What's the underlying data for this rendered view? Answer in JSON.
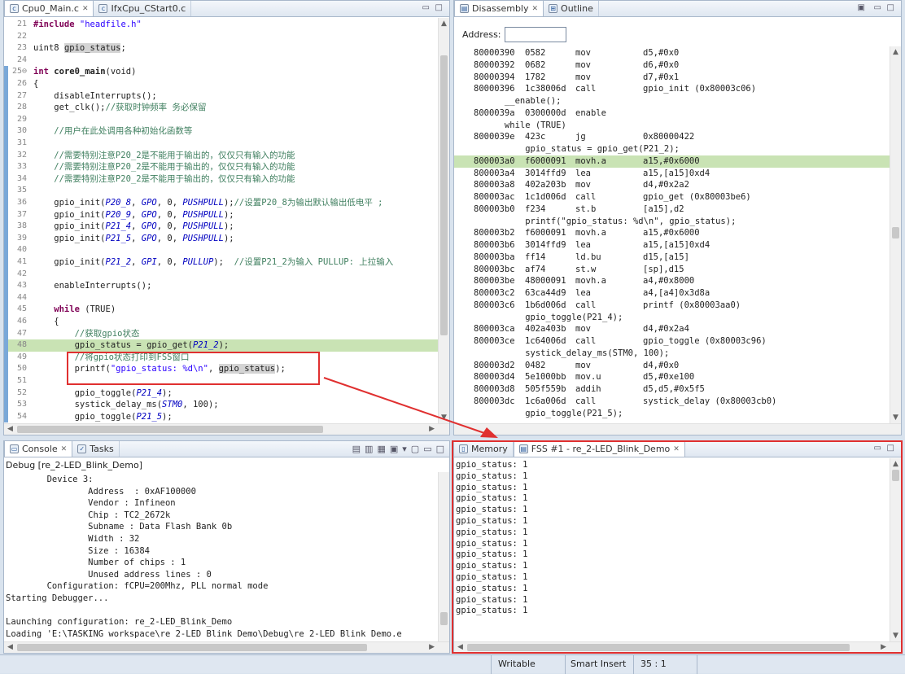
{
  "editor": {
    "tabs": [
      {
        "label": "Cpu0_Main.c",
        "close": "✕"
      },
      {
        "label": "IfxCpu_CStart0.c"
      }
    ],
    "lines": [
      {
        "n": "21",
        "tokens": [
          {
            "t": "#include ",
            "c": "kw"
          },
          {
            "t": "\"headfile.h\"",
            "c": "str"
          }
        ]
      },
      {
        "n": "22",
        "tokens": []
      },
      {
        "n": "23",
        "tokens": [
          {
            "t": "uint8 ",
            "c": ""
          },
          {
            "t": "gpio_status",
            "c": "hl"
          },
          {
            "t": ";",
            "c": ""
          }
        ]
      },
      {
        "n": "24",
        "tokens": []
      },
      {
        "n": "25⊖",
        "tokens": [
          {
            "t": "int ",
            "c": "kw"
          },
          {
            "t": "core0_main",
            "c": "b"
          },
          {
            "t": "(void)",
            "c": ""
          }
        ]
      },
      {
        "n": "26",
        "tokens": [
          {
            "t": "{",
            "c": ""
          }
        ]
      },
      {
        "n": "27",
        "tokens": [
          {
            "t": "    disableInterrupts();",
            "c": ""
          }
        ]
      },
      {
        "n": "28",
        "tokens": [
          {
            "t": "    get_clk();",
            "c": ""
          },
          {
            "t": "//获取时钟频率 务必保留",
            "c": "cm"
          }
        ]
      },
      {
        "n": "29",
        "tokens": []
      },
      {
        "n": "30",
        "tokens": [
          {
            "t": "    //用户在此处调用各种初始化函数等",
            "c": "cm"
          }
        ]
      },
      {
        "n": "31",
        "tokens": []
      },
      {
        "n": "32",
        "tokens": [
          {
            "t": "    //需要特别注意P20_2是不能用于输出的，仅仅只有输入的功能",
            "c": "cm"
          }
        ]
      },
      {
        "n": "33",
        "tokens": [
          {
            "t": "    //需要特别注意P20_2是不能用于输出的，仅仅只有输入的功能",
            "c": "cm"
          }
        ]
      },
      {
        "n": "34",
        "tokens": [
          {
            "t": "    //需要特别注意P20_2是不能用于输出的，仅仅只有输入的功能",
            "c": "cm"
          }
        ]
      },
      {
        "n": "35",
        "tokens": []
      },
      {
        "n": "36",
        "tokens": [
          {
            "t": "    gpio_init(",
            "c": ""
          },
          {
            "t": "P20_8",
            "c": "it"
          },
          {
            "t": ", ",
            "c": ""
          },
          {
            "t": "GPO",
            "c": "it"
          },
          {
            "t": ", 0, ",
            "c": ""
          },
          {
            "t": "PUSHPULL",
            "c": "it"
          },
          {
            "t": ");",
            "c": ""
          },
          {
            "t": "//设置P20_8为输出默认输出低电平 ;",
            "c": "cm"
          }
        ]
      },
      {
        "n": "37",
        "tokens": [
          {
            "t": "    gpio_init(",
            "c": ""
          },
          {
            "t": "P20_9",
            "c": "it"
          },
          {
            "t": ", ",
            "c": ""
          },
          {
            "t": "GPO",
            "c": "it"
          },
          {
            "t": ", 0, ",
            "c": ""
          },
          {
            "t": "PUSHPULL",
            "c": "it"
          },
          {
            "t": ");",
            "c": ""
          }
        ]
      },
      {
        "n": "38",
        "tokens": [
          {
            "t": "    gpio_init(",
            "c": ""
          },
          {
            "t": "P21_4",
            "c": "it"
          },
          {
            "t": ", ",
            "c": ""
          },
          {
            "t": "GPO",
            "c": "it"
          },
          {
            "t": ", 0, ",
            "c": ""
          },
          {
            "t": "PUSHPULL",
            "c": "it"
          },
          {
            "t": ");",
            "c": ""
          }
        ]
      },
      {
        "n": "39",
        "tokens": [
          {
            "t": "    gpio_init(",
            "c": ""
          },
          {
            "t": "P21_5",
            "c": "it"
          },
          {
            "t": ", ",
            "c": ""
          },
          {
            "t": "GPO",
            "c": "it"
          },
          {
            "t": ", 0, ",
            "c": ""
          },
          {
            "t": "PUSHPULL",
            "c": "it"
          },
          {
            "t": ");",
            "c": ""
          }
        ]
      },
      {
        "n": "40",
        "tokens": []
      },
      {
        "n": "41",
        "tokens": [
          {
            "t": "    gpio_init(",
            "c": ""
          },
          {
            "t": "P21_2",
            "c": "it"
          },
          {
            "t": ", ",
            "c": ""
          },
          {
            "t": "GPI",
            "c": "it"
          },
          {
            "t": ", 0, ",
            "c": ""
          },
          {
            "t": "PULLUP",
            "c": "it"
          },
          {
            "t": ");  ",
            "c": ""
          },
          {
            "t": "//设置P21_2为输入 PULLUP: 上拉输入",
            "c": "cm"
          }
        ]
      },
      {
        "n": "42",
        "tokens": []
      },
      {
        "n": "43",
        "tokens": [
          {
            "t": "    enableInterrupts();",
            "c": ""
          }
        ]
      },
      {
        "n": "44",
        "tokens": []
      },
      {
        "n": "45",
        "tokens": [
          {
            "t": "    while ",
            "c": "kw"
          },
          {
            "t": "(TRUE)",
            "c": ""
          }
        ]
      },
      {
        "n": "46",
        "tokens": [
          {
            "t": "    {",
            "c": ""
          }
        ]
      },
      {
        "n": "47",
        "tokens": [
          {
            "t": "        //获取gpio状态",
            "c": "cm"
          }
        ]
      },
      {
        "n": "48",
        "tokens": [
          {
            "t": "        gpio_status = gpio_get(",
            "c": ""
          },
          {
            "t": "P21_2",
            "c": "it"
          },
          {
            "t": ");",
            "c": ""
          }
        ],
        "current": true
      },
      {
        "n": "49",
        "tokens": [
          {
            "t": "        //将gpio状态打印到FSS窗口",
            "c": "cm"
          }
        ]
      },
      {
        "n": "50",
        "tokens": [
          {
            "t": "        printf(",
            "c": ""
          },
          {
            "t": "\"gpio_status: %d\\n\"",
            "c": "str"
          },
          {
            "t": ", ",
            "c": ""
          },
          {
            "t": "gpio_status",
            "c": "hl"
          },
          {
            "t": ");",
            "c": ""
          }
        ]
      },
      {
        "n": "51",
        "tokens": []
      },
      {
        "n": "52",
        "tokens": [
          {
            "t": "        gpio_toggle(",
            "c": ""
          },
          {
            "t": "P21_4",
            "c": "it"
          },
          {
            "t": ");",
            "c": ""
          }
        ]
      },
      {
        "n": "53",
        "tokens": [
          {
            "t": "        systick_delay_ms(",
            "c": ""
          },
          {
            "t": "STM0",
            "c": "it"
          },
          {
            "t": ", 100);",
            "c": ""
          }
        ]
      },
      {
        "n": "54",
        "tokens": [
          {
            "t": "        gpio_toggle(",
            "c": ""
          },
          {
            "t": "P21_5",
            "c": "it"
          },
          {
            "t": ");",
            "c": ""
          }
        ]
      }
    ]
  },
  "disassembly": {
    "tabs": [
      {
        "label": "Disassembly",
        "close": "✕"
      },
      {
        "label": "Outline"
      }
    ],
    "address_label": "Address:",
    "address_value": "",
    "lines": [
      {
        "addr": "80000390",
        "hex": "0582",
        "op": "mov",
        "args": "d5,#0x0"
      },
      {
        "addr": "80000392",
        "hex": "0682",
        "op": "mov",
        "args": "d6,#0x0"
      },
      {
        "addr": "80000394",
        "hex": "1782",
        "op": "mov",
        "args": "d7,#0x1"
      },
      {
        "addr": "80000396",
        "hex": "1c38006d",
        "op": "call",
        "args": "gpio_init (0x80003c06)"
      },
      {
        "src": "      __enable();"
      },
      {
        "addr": "8000039a",
        "hex": "0300000d",
        "op": "enable",
        "args": ""
      },
      {
        "src": "      while (TRUE)"
      },
      {
        "addr": "8000039e",
        "hex": "423c",
        "op": "jg",
        "args": "0x80000422"
      },
      {
        "src": "          gpio_status = gpio_get(P21_2);"
      },
      {
        "addr": "800003a0",
        "hex": "f6000091",
        "op": "movh.a",
        "args": "a15,#0x6000",
        "current": true
      },
      {
        "addr": "800003a4",
        "hex": "3014ffd9",
        "op": "lea",
        "args": "a15,[a15]0xd4"
      },
      {
        "addr": "800003a8",
        "hex": "402a203b",
        "op": "mov",
        "args": "d4,#0x2a2"
      },
      {
        "addr": "800003ac",
        "hex": "1c1d006d",
        "op": "call",
        "args": "gpio_get (0x80003be6)"
      },
      {
        "addr": "800003b0",
        "hex": "f234",
        "op": "st.b",
        "args": "[a15],d2"
      },
      {
        "src": "          printf(\"gpio_status: %d\\n\", gpio_status);"
      },
      {
        "addr": "800003b2",
        "hex": "f6000091",
        "op": "movh.a",
        "args": "a15,#0x6000"
      },
      {
        "addr": "800003b6",
        "hex": "3014ffd9",
        "op": "lea",
        "args": "a15,[a15]0xd4"
      },
      {
        "addr": "800003ba",
        "hex": "ff14",
        "op": "ld.bu",
        "args": "d15,[a15]"
      },
      {
        "addr": "800003bc",
        "hex": "af74",
        "op": "st.w",
        "args": "[sp],d15"
      },
      {
        "addr": "800003be",
        "hex": "48000091",
        "op": "movh.a",
        "args": "a4,#0x8000"
      },
      {
        "addr": "800003c2",
        "hex": "63ca44d9",
        "op": "lea",
        "args": "a4,[a4]0x3d8a"
      },
      {
        "addr": "800003c6",
        "hex": "1b6d006d",
        "op": "call",
        "args": "printf (0x80003aa0)"
      },
      {
        "src": "          gpio_toggle(P21_4);"
      },
      {
        "addr": "800003ca",
        "hex": "402a403b",
        "op": "mov",
        "args": "d4,#0x2a4"
      },
      {
        "addr": "800003ce",
        "hex": "1c64006d",
        "op": "call",
        "args": "gpio_toggle (0x80003c96)"
      },
      {
        "src": "          systick_delay_ms(STM0, 100);"
      },
      {
        "addr": "800003d2",
        "hex": "0482",
        "op": "mov",
        "args": "d4,#0x0"
      },
      {
        "addr": "800003d4",
        "hex": "5e1000bb",
        "op": "mov.u",
        "args": "d5,#0xe100"
      },
      {
        "addr": "800003d8",
        "hex": "505f559b",
        "op": "addih",
        "args": "d5,d5,#0x5f5"
      },
      {
        "addr": "800003dc",
        "hex": "1c6a006d",
        "op": "call",
        "args": "systick_delay (0x80003cb0)"
      },
      {
        "src": "          gpio_toggle(P21_5);"
      }
    ]
  },
  "console": {
    "tabs": [
      {
        "label": "Console",
        "close": "✕"
      },
      {
        "label": "Tasks"
      }
    ],
    "subtitle": "Debug [re_2-LED_Blink_Demo]",
    "lines": [
      "        Device 3:",
      "                Address  : 0xAF100000",
      "                Vendor : Infineon",
      "                Chip : TC2_2672k",
      "                Subname : Data Flash Bank 0b",
      "                Width : 32",
      "                Size : 16384",
      "                Number of chips : 1",
      "                Unused address lines : 0",
      "        Configuration: fCPU=200Mhz, PLL normal mode",
      "Starting Debugger...",
      "",
      "Launching configuration: re_2-LED_Blink_Demo",
      "Loading 'E:\\TASKING workspace\\re 2-LED Blink Demo\\Debug\\re 2-LED Blink Demo.e"
    ]
  },
  "fss": {
    "tabs": [
      {
        "label": "Memory"
      },
      {
        "label": "FSS #1 - re_2-LED_Blink_Demo",
        "close": "✕"
      }
    ],
    "lines": [
      "gpio_status: 1",
      "gpio_status: 1",
      "gpio_status: 1",
      "gpio_status: 1",
      "gpio_status: 1",
      "gpio_status: 1",
      "gpio_status: 1",
      "gpio_status: 1",
      "gpio_status: 1",
      "gpio_status: 1",
      "gpio_status: 1",
      "gpio_status: 1",
      "gpio_status: 1",
      "gpio_status: 1"
    ]
  },
  "statusbar": {
    "mode": "Writable",
    "insert": "Smart Insert",
    "position": "35 : 1"
  },
  "colors": {
    "current_line": "#c9e3b4",
    "comment": "#3f7f5f",
    "keyword": "#7f0055",
    "string": "#2a00ff",
    "italic": "#0000c0",
    "annotation": "#e03030"
  }
}
